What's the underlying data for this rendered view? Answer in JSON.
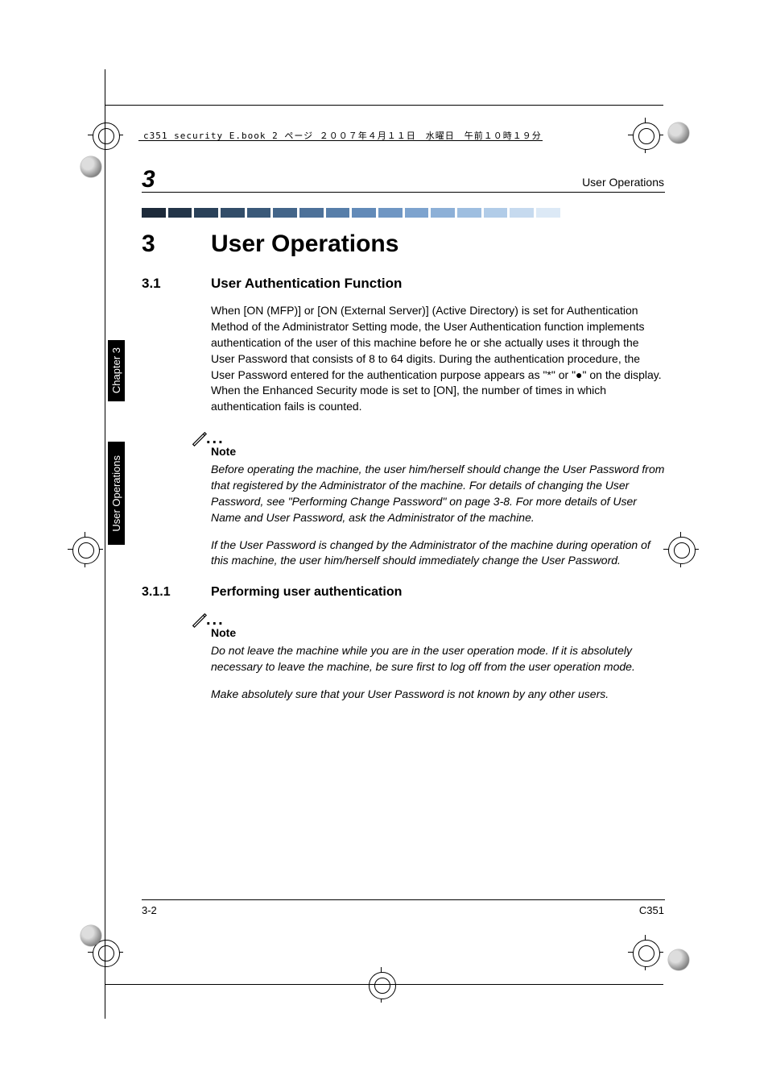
{
  "file_line": "c351_security_E.book  2 ページ  ２００７年４月１１日　水曜日　午前１０時１９分",
  "header": {
    "chapter_number": "3",
    "running_title": "User Operations"
  },
  "sidetabs": {
    "chapter": "Chapter 3",
    "section": "User Operations"
  },
  "h1": {
    "num": "3",
    "text": "User Operations"
  },
  "h2": {
    "num": "3.1",
    "text": "User Authentication Function"
  },
  "para1": "When [ON (MFP)] or [ON (External Server)] (Active Directory) is set for Authentication Method of the Administrator Setting mode, the User Authentication function implements authentication of the user of this machine before he or she actually uses it through the User Password that consists of 8 to 64 digits. During the authentication procedure, the User Password entered for the authentication purpose appears as \"*\" or \"●\" on the display. When the Enhanced Security mode is set to [ON], the number of times in which authentication fails is counted.",
  "note1_label": "Note",
  "note1_a": "Before operating the machine, the user him/herself should change the User Password from that registered by the Administrator of the machine. For details of changing the User Password, see \"Performing Change Password\" on page 3-8. For more details of User Name and User Password, ask the Administrator of the machine.",
  "note1_b": "If the User Password is changed by the Administrator of the machine during operation of this machine, the user him/herself should immediately change the User Password.",
  "h3": {
    "num": "3.1.1",
    "text": "Performing user authentication"
  },
  "note2_label": "Note",
  "note2_a": "Do not leave the machine while you are in the user operation mode. If it is absolutely necessary to leave the machine, be sure first to log off from the user operation mode.",
  "note2_b": "Make absolutely sure that your User Password is not known by any other users.",
  "footer": {
    "page": "3-2",
    "model": "C351"
  }
}
